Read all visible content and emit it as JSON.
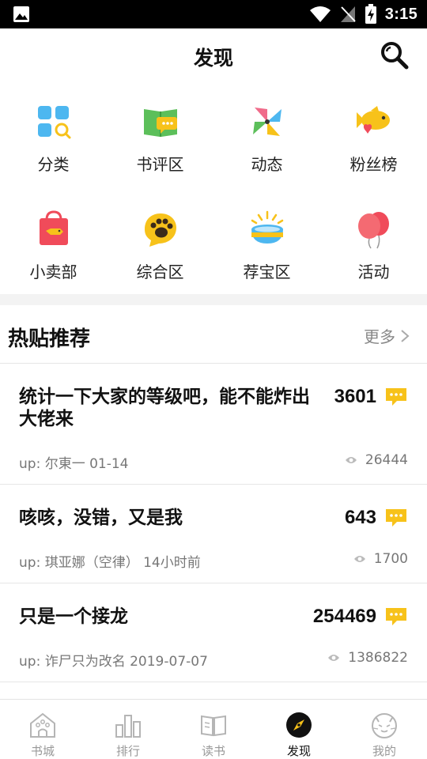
{
  "status_bar": {
    "time": "3:15"
  },
  "header": {
    "title": "发现"
  },
  "categories": [
    {
      "label": "分类",
      "icon": "category-grid-icon"
    },
    {
      "label": "书评区",
      "icon": "book-comment-icon"
    },
    {
      "label": "动态",
      "icon": "pinwheel-icon"
    },
    {
      "label": "粉丝榜",
      "icon": "fish-heart-icon"
    },
    {
      "label": "小卖部",
      "icon": "shopping-bag-icon"
    },
    {
      "label": "综合区",
      "icon": "paw-icon"
    },
    {
      "label": "荐宝区",
      "icon": "treasure-bowl-icon"
    },
    {
      "label": "活动",
      "icon": "balloons-icon"
    }
  ],
  "hot_posts": {
    "title": "热贴推荐",
    "more_label": "更多",
    "posts": [
      {
        "title": "统计一下大家的等级吧，能不能炸出大佬来",
        "comments": "3601",
        "meta": "up: 尔東一 01-14",
        "views": "26444"
      },
      {
        "title": "咳咳，没错，又是我",
        "comments": "643",
        "meta": "up: 琪亚娜（空律） 14小时前",
        "views": "1700"
      },
      {
        "title": "只是一个接龙",
        "comments": "254469",
        "meta": "up: 诈尸只为改名 2019-07-07",
        "views": "1386822"
      }
    ]
  },
  "bottom_nav": [
    {
      "label": "书城",
      "icon": "bookstore-house-icon",
      "active": false
    },
    {
      "label": "排行",
      "icon": "ranking-bars-icon",
      "active": false
    },
    {
      "label": "读书",
      "icon": "open-book-icon",
      "active": false
    },
    {
      "label": "发现",
      "icon": "compass-icon",
      "active": true
    },
    {
      "label": "我的",
      "icon": "cat-face-icon",
      "active": false
    }
  ],
  "colors": {
    "accent_yellow": "#f7c21a",
    "active_nav": "#111111"
  }
}
